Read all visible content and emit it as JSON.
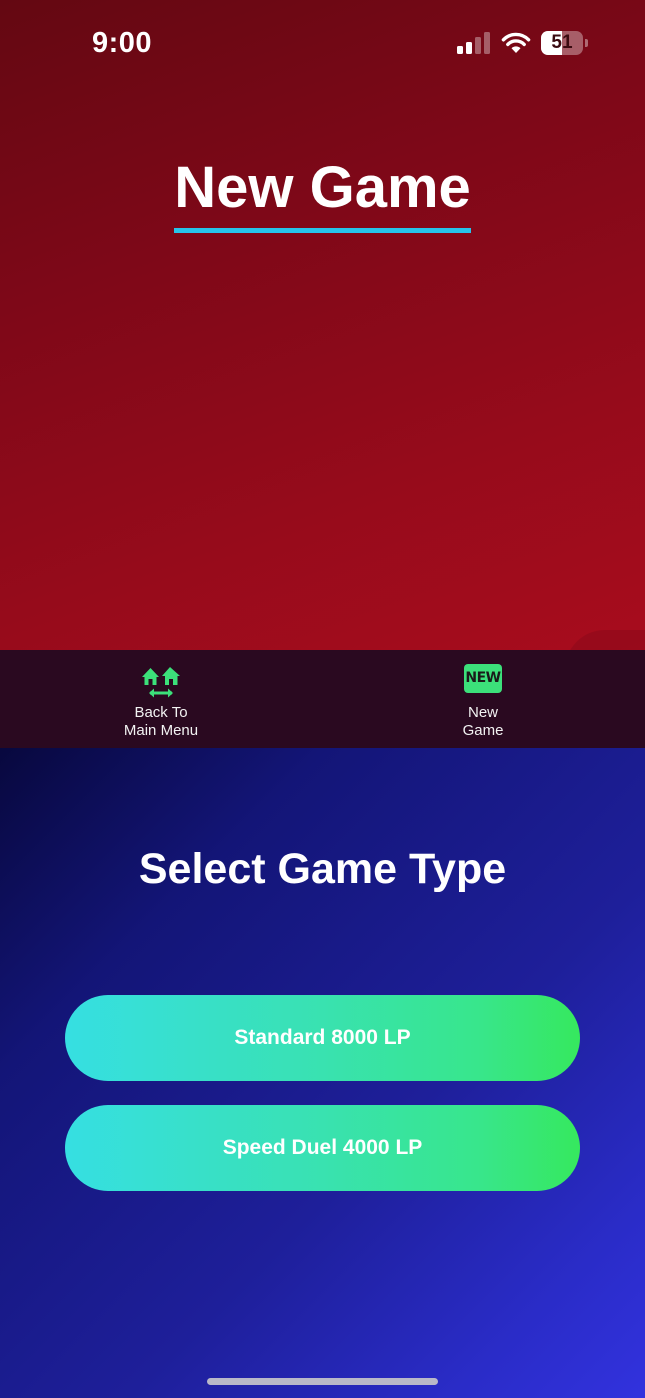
{
  "status_bar": {
    "time": "9:00",
    "battery_level": "51",
    "battery_fraction": 0.51,
    "signal_bars_active": 2,
    "signal_bars_total": 4
  },
  "header": {
    "title": "New Game"
  },
  "tab_bar": {
    "items": [
      {
        "label": "Back To\nMain Menu",
        "icon": "home-swap-icon"
      },
      {
        "label": "New\nGame",
        "icon": "new-badge-icon",
        "badge_text": "NEW"
      }
    ]
  },
  "main": {
    "heading": "Select Game Type",
    "buttons": [
      {
        "label": "Standard 8000 LP"
      },
      {
        "label": "Speed Duel 4000 LP"
      }
    ]
  },
  "colors": {
    "accent_underline": "#27c4ea",
    "tab_icon_green": "#3ce07a",
    "button_gradient_start": "#36dfe2",
    "button_gradient_end": "#36e85e",
    "top_background": "#8a0a19",
    "bottom_background": "#1e1f9a"
  }
}
